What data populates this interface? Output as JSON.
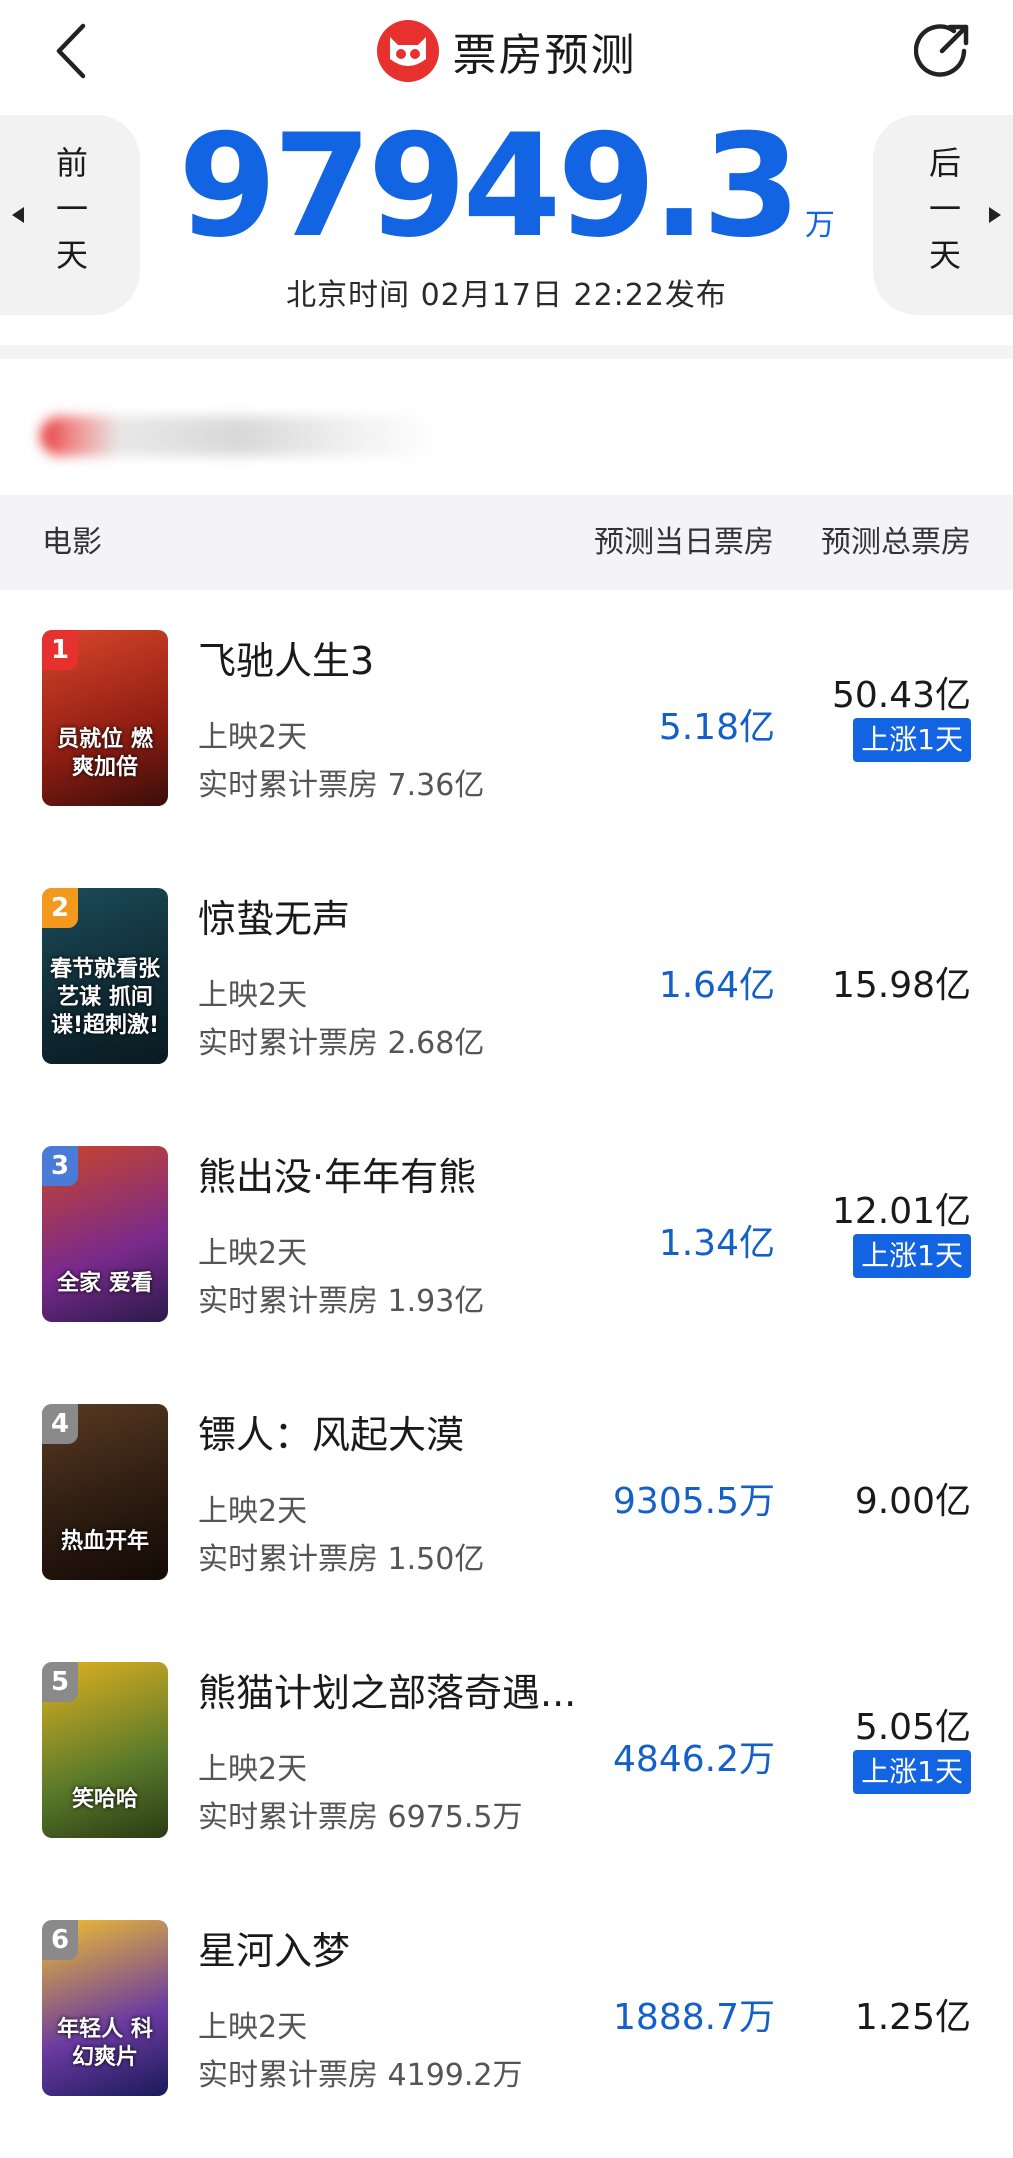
{
  "header": {
    "title": "票房预测",
    "back_icon": "chevron-left-icon",
    "share_icon": "share-icon",
    "logo": "cat-eye-logo"
  },
  "date_nav": {
    "prev_label": "前一天",
    "next_label": "后一天"
  },
  "summary": {
    "total_value": "97949.3",
    "total_unit": "万",
    "published": "北京时间  02月17日  22:22发布"
  },
  "table": {
    "col_movie": "电影",
    "col_day": "预测当日票房",
    "col_total": "预测总票房"
  },
  "colors": {
    "accent": "#1264e3",
    "rank_top": "#e6312e",
    "rank_second": "#f39a1e",
    "rank_third": "#4a7bd6",
    "rank_other": "#8a8a8a"
  },
  "films": [
    {
      "rank": "1",
      "name": "飞驰人生3",
      "days": "上映2天",
      "cumulative": "实时累计票房 7.36亿",
      "pred_day": "5.18亿",
      "pred_total": "50.43亿",
      "tag": "上涨1天",
      "poster_text": "员就位 燃爽加倍"
    },
    {
      "rank": "2",
      "name": "惊蛰无声",
      "days": "上映2天",
      "cumulative": "实时累计票房 2.68亿",
      "pred_day": "1.64亿",
      "pred_total": "15.98亿",
      "tag": "",
      "poster_text": "春节就看张艺谋 抓间谍!超刺激!"
    },
    {
      "rank": "3",
      "name": "熊出没·年年有熊",
      "days": "上映2天",
      "cumulative": "实时累计票房 1.93亿",
      "pred_day": "1.34亿",
      "pred_total": "12.01亿",
      "tag": "上涨1天",
      "poster_text": "全家 爱看"
    },
    {
      "rank": "4",
      "name": "镖人：风起大漠",
      "days": "上映2天",
      "cumulative": "实时累计票房 1.50亿",
      "pred_day": "9305.5万",
      "pred_total": "9.00亿",
      "tag": "",
      "poster_text": "热血开年"
    },
    {
      "rank": "5",
      "name": "熊猫计划之部落奇遇...",
      "days": "上映2天",
      "cumulative": "实时累计票房 6975.5万",
      "pred_day": "4846.2万",
      "pred_total": "5.05亿",
      "tag": "上涨1天",
      "poster_text": "笑哈哈"
    },
    {
      "rank": "6",
      "name": "星河入梦",
      "days": "上映2天",
      "cumulative": "实时累计票房 4199.2万",
      "pred_day": "1888.7万",
      "pred_total": "1.25亿",
      "tag": "",
      "poster_text": "年轻人 科幻爽片"
    }
  ]
}
